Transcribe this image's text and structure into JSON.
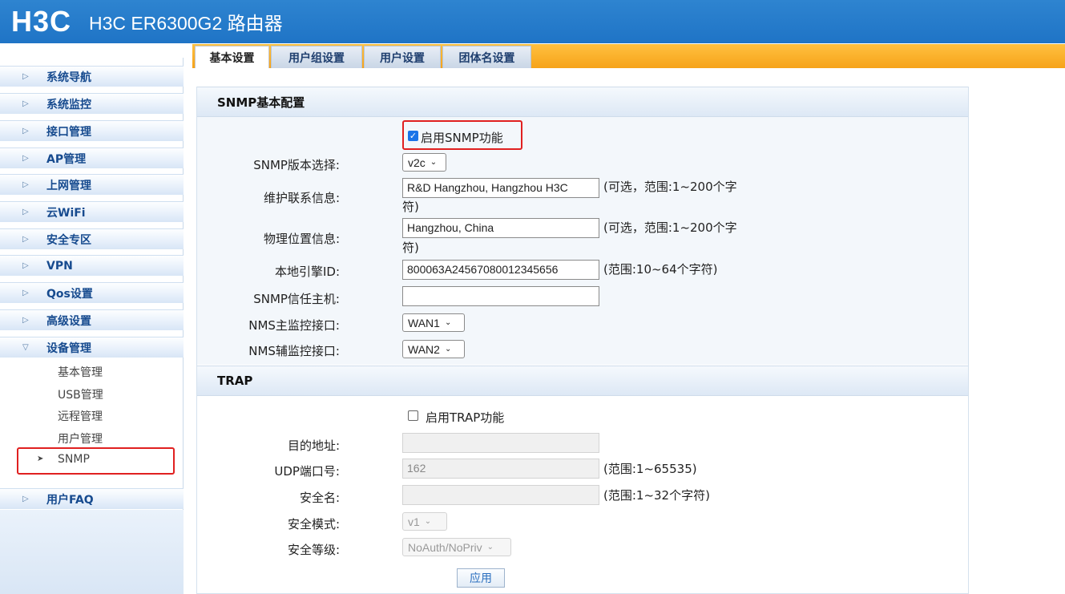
{
  "header": {
    "logo": "H3C",
    "title": "H3C ER6300G2 路由器"
  },
  "sidebar": {
    "items": [
      {
        "label": "系统导航"
      },
      {
        "label": "系统监控"
      },
      {
        "label": "接口管理"
      },
      {
        "label": "AP管理"
      },
      {
        "label": "上网管理"
      },
      {
        "label": "云WiFi"
      },
      {
        "label": "安全专区"
      },
      {
        "label": "VPN"
      },
      {
        "label": "Qos设置"
      },
      {
        "label": "高级设置"
      },
      {
        "label": "设备管理"
      }
    ],
    "sub_items": [
      {
        "label": "基本管理"
      },
      {
        "label": "USB管理"
      },
      {
        "label": "远程管理"
      },
      {
        "label": "用户管理"
      },
      {
        "label": "SNMP"
      }
    ],
    "faq": "用户FAQ"
  },
  "tabs": [
    {
      "label": "基本设置"
    },
    {
      "label": "用户组设置"
    },
    {
      "label": "用户设置"
    },
    {
      "label": "团体名设置"
    }
  ],
  "snmp": {
    "section_title": "SNMP基本配置",
    "enable_label": "启用SNMP功能",
    "enable_checked": true,
    "version_label": "SNMP版本选择:",
    "version_value": "v2c",
    "contact_label": "维护联系信息:",
    "contact_value": "R&D Hangzhou, Hangzhou H3C",
    "contact_hint_1": "(可选，范围:1~200个字",
    "contact_hint_2": "符)",
    "location_label": "物理位置信息:",
    "location_value": "Hangzhou, China",
    "location_hint_1": "(可选，范围:1~200个字",
    "location_hint_2": "符)",
    "engine_label": "本地引擎ID:",
    "engine_value": "800063A24567080012345656",
    "engine_hint": "(范围:10~64个字符)",
    "trust_label": "SNMP信任主机:",
    "trust_value": "",
    "nms_primary_label": "NMS主监控接口:",
    "nms_primary_value": "WAN1",
    "nms_secondary_label": "NMS辅监控接口:",
    "nms_secondary_value": "WAN2"
  },
  "trap": {
    "section_title": "TRAP",
    "enable_label": "启用TRAP功能",
    "enable_checked": false,
    "dest_label": "目的地址:",
    "dest_value": "",
    "port_label": "UDP端口号:",
    "port_value": "162",
    "port_hint": "(范围:1~65535)",
    "secname_label": "安全名:",
    "secname_value": "",
    "secname_hint": "(范围:1~32个字符)",
    "secmode_label": "安全模式:",
    "secmode_value": "v1",
    "seclevel_label": "安全等级:",
    "seclevel_value": "NoAuth/NoPriv"
  },
  "apply_label": "应用",
  "colors": {
    "header": "#1f74c6",
    "tabbar": "#f6a319",
    "highlight": "#e02020"
  }
}
